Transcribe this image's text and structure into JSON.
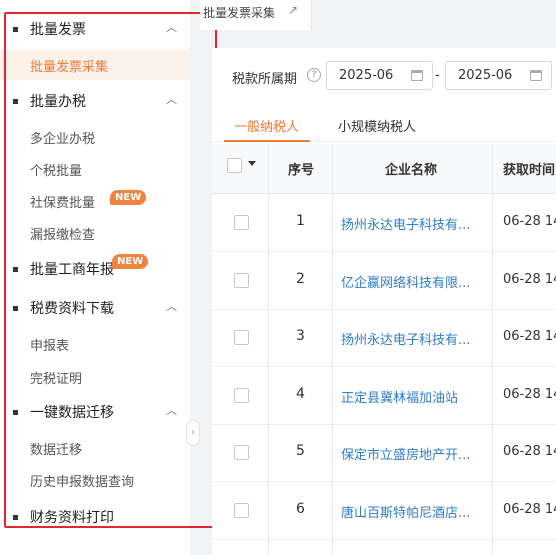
{
  "colors": {
    "accent": "#f07a36",
    "highlight_border": "#e0262f",
    "link": "#2f7dcc",
    "badge": "#f0843f"
  },
  "sidebar": {
    "groups": [
      {
        "label": "批量发票",
        "expanded": true,
        "items": [
          {
            "label": "批量发票采集",
            "active": true
          }
        ]
      },
      {
        "label": "批量办税",
        "expanded": true,
        "items": [
          {
            "label": "多企业办税"
          },
          {
            "label": "个税批量"
          },
          {
            "label": "社保费批量",
            "badge": "NEW"
          },
          {
            "label": "漏报缴检查"
          }
        ]
      },
      {
        "label": "批量工商年报",
        "badge": "NEW",
        "items": []
      },
      {
        "label": "税费资料下载",
        "expanded": true,
        "items": [
          {
            "label": "申报表"
          },
          {
            "label": "完税证明"
          }
        ]
      },
      {
        "label": "一键数据迁移",
        "expanded": true,
        "items": [
          {
            "label": "数据迁移"
          },
          {
            "label": "历史申报数据查询"
          }
        ]
      },
      {
        "label": "财务资料打印",
        "items": []
      }
    ],
    "collapse_icon": "chevron-left-icon"
  },
  "page_tab": {
    "label": "批量发票采集",
    "icon": "external-link-icon"
  },
  "filter": {
    "label": "税款所属期",
    "help_icon": "question-icon",
    "start": "2025-06",
    "separator": "-",
    "end": "2025-06",
    "calendar_icon": "calendar-icon"
  },
  "tabs": [
    {
      "label": "一般纳税人",
      "active": true
    },
    {
      "label": "小规模纳税人"
    }
  ],
  "table": {
    "headers": {
      "index": "序号",
      "company": "企业名称",
      "time": "获取时间"
    },
    "rows": [
      {
        "index": "1",
        "company": "扬州永达电子科技有...",
        "time": "06-28 14"
      },
      {
        "index": "2",
        "company": "亿企赢网络科技有限...",
        "time": "06-28 14"
      },
      {
        "index": "3",
        "company": "扬州永达电子科技有...",
        "time": "06-28 14"
      },
      {
        "index": "4",
        "company": "正定县冀林福加油站",
        "time": "06-28 14"
      },
      {
        "index": "5",
        "company": "保定市立盛房地产开...",
        "time": "06-28 14"
      },
      {
        "index": "6",
        "company": "唐山百斯特帕尼酒店...",
        "time": "06-28 14"
      }
    ]
  }
}
